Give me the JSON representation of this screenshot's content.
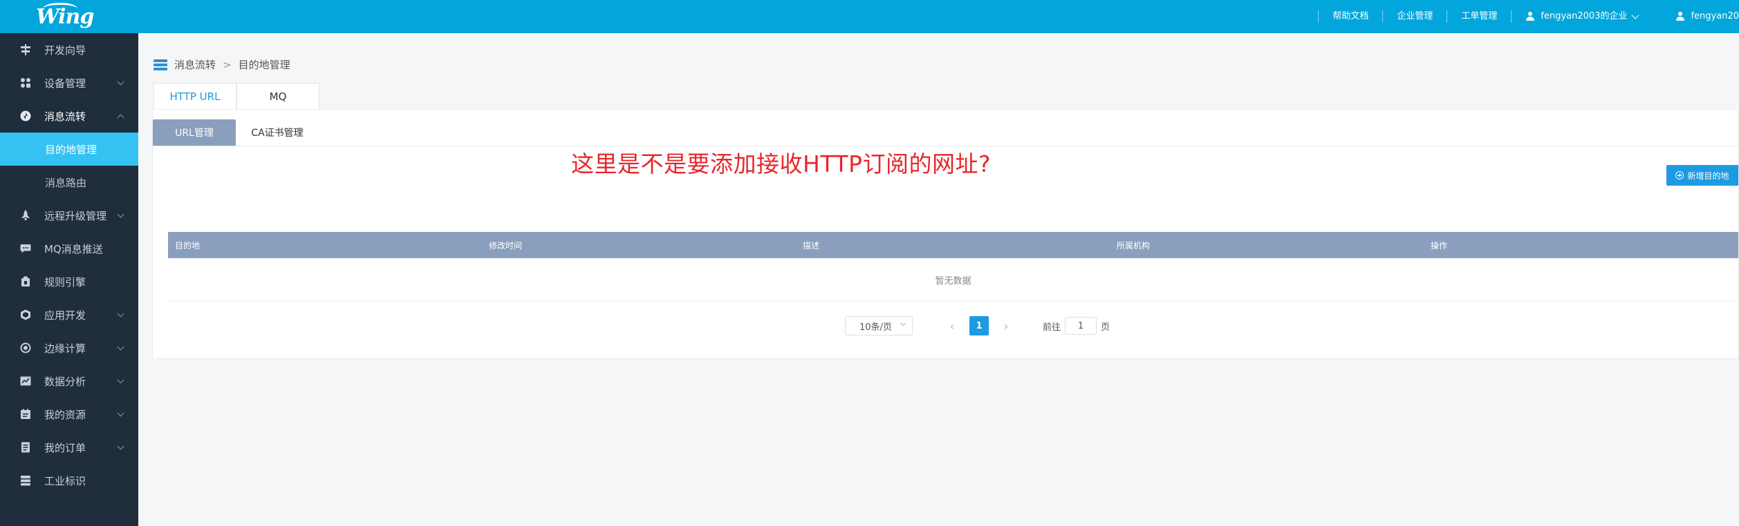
{
  "header": {
    "logo_text": "Wing",
    "links": [
      "帮助文档",
      "企业管理",
      "工单管理"
    ],
    "enterprise_user": "fengyan2003的企业",
    "user": "fengyan20",
    "brand_color": "#02a6dc"
  },
  "sidebar": {
    "items": [
      {
        "label": "开发向导",
        "icon": "guide-icon",
        "has_arrow": false
      },
      {
        "label": "设备管理",
        "icon": "devices-icon",
        "has_arrow": true
      },
      {
        "label": "消息流转",
        "icon": "message-flow-icon",
        "has_arrow": true,
        "open": true
      },
      {
        "label": "远程升级管理",
        "icon": "rocket-icon",
        "has_arrow": true
      },
      {
        "label": "MQ消息推送",
        "icon": "chat-icon",
        "has_arrow": false
      },
      {
        "label": "规则引擎",
        "icon": "rule-icon",
        "has_arrow": false
      },
      {
        "label": "应用开发",
        "icon": "app-dev-icon",
        "has_arrow": true
      },
      {
        "label": "边缘计算",
        "icon": "edge-icon",
        "has_arrow": true
      },
      {
        "label": "数据分析",
        "icon": "analytics-icon",
        "has_arrow": true
      },
      {
        "label": "我的资源",
        "icon": "resources-icon",
        "has_arrow": true
      },
      {
        "label": "我的订单",
        "icon": "orders-icon",
        "has_arrow": true
      },
      {
        "label": "工业标识",
        "icon": "industry-id-icon",
        "has_arrow": false
      }
    ],
    "subitems": [
      "目的地管理",
      "消息路由"
    ],
    "active_sub": "目的地管理",
    "bg_color": "#1f2d3d",
    "active_color": "#35c2f3"
  },
  "breadcrumb": [
    "消息流转",
    "目的地管理"
  ],
  "breadcrumb_sep": ">",
  "tabs": [
    "HTTP URL",
    "MQ"
  ],
  "subtabs": [
    "URL管理",
    "CA证书管理"
  ],
  "annotation": "这里是不是要添加接收HTTP订阅的网址?",
  "add_button": "新增目的地",
  "table": {
    "columns": [
      "目的地",
      "修改时间",
      "描述",
      "所属机构",
      "操作"
    ],
    "empty_text": "暂无数据"
  },
  "pagination": {
    "page_size": "10条/页",
    "current_page": "1",
    "goto_label": "前往",
    "goto_value": "1",
    "page_unit": "页"
  }
}
